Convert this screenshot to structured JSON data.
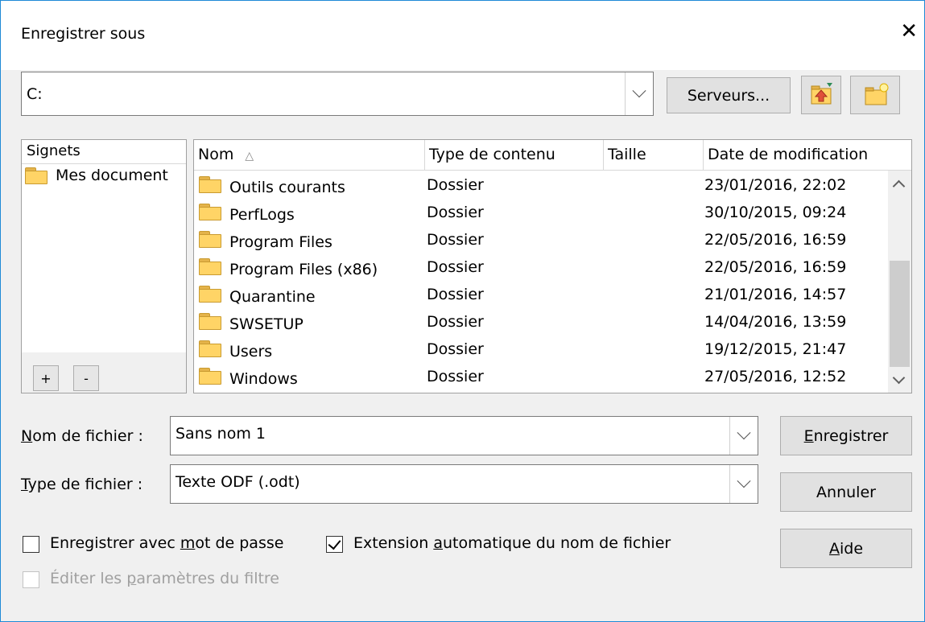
{
  "window": {
    "title": "Enregistrer sous",
    "close_glyph": "✕"
  },
  "path": {
    "value": "C:"
  },
  "toolbar": {
    "servers_label": "Serveurs...",
    "up_icon": "folder-up-icon",
    "new_folder_icon": "new-folder-icon"
  },
  "bookmarks": {
    "header": "Signets",
    "items": [
      {
        "label": "Mes document"
      }
    ],
    "add_label": "+",
    "remove_label": "-"
  },
  "file_list": {
    "columns": [
      "Nom",
      "Type de contenu",
      "Taille",
      "Date de modification"
    ],
    "sort_indicator": "△",
    "rows": [
      {
        "name": "Outils courants",
        "type": "Dossier",
        "size": "",
        "date": "23/01/2016, 22:02"
      },
      {
        "name": "PerfLogs",
        "type": "Dossier",
        "size": "",
        "date": "30/10/2015, 09:24"
      },
      {
        "name": "Program Files",
        "type": "Dossier",
        "size": "",
        "date": "22/05/2016, 16:59"
      },
      {
        "name": "Program Files (x86)",
        "type": "Dossier",
        "size": "",
        "date": "22/05/2016, 16:59"
      },
      {
        "name": "Quarantine",
        "type": "Dossier",
        "size": "",
        "date": "21/01/2016, 14:57"
      },
      {
        "name": "SWSETUP",
        "type": "Dossier",
        "size": "",
        "date": "14/04/2016, 13:59"
      },
      {
        "name": "Users",
        "type": "Dossier",
        "size": "",
        "date": "19/12/2015, 21:47"
      },
      {
        "name": "Windows",
        "type": "Dossier",
        "size": "",
        "date": "27/05/2016, 12:52"
      }
    ]
  },
  "filename": {
    "label_u": "N",
    "label_rest": "om de fichier :",
    "value": "Sans nom 1"
  },
  "filetype": {
    "label_u": "T",
    "label_rest": "ype de fichier :",
    "value": "Texte ODF (.odt)"
  },
  "buttons": {
    "save_u": "E",
    "save_rest": "nregistrer",
    "cancel": "Annuler",
    "help_u": "A",
    "help_rest": "ide"
  },
  "options": {
    "password": {
      "pre": "Enregistrer avec ",
      "u": "m",
      "post": "ot de passe",
      "checked": false
    },
    "extension": {
      "pre": "Extension ",
      "u": "a",
      "post": "utomatique du nom de fichier",
      "checked": true
    },
    "filter": {
      "pre": "Éditer les ",
      "u": "p",
      "post": "aramètres du filtre",
      "checked": false,
      "enabled": false
    }
  }
}
